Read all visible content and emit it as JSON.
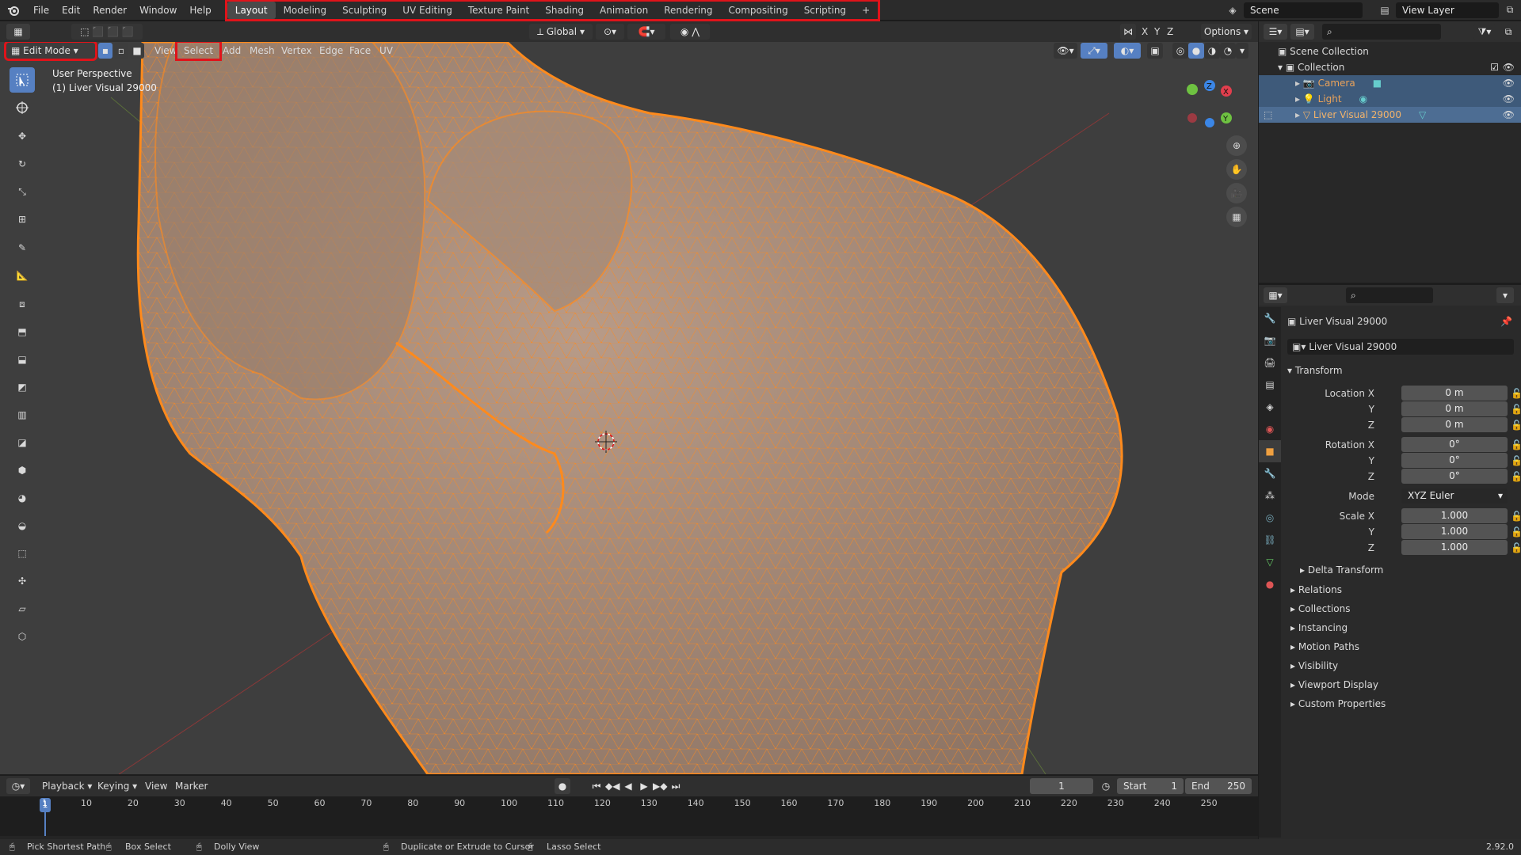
{
  "top_menu": [
    "File",
    "Edit",
    "Render",
    "Window",
    "Help"
  ],
  "workspace_tabs": [
    "Layout",
    "Modeling",
    "Sculpting",
    "UV Editing",
    "Texture Paint",
    "Shading",
    "Animation",
    "Rendering",
    "Compositing",
    "Scripting",
    "+"
  ],
  "scene": "Scene",
  "view_layer": "View Layer",
  "header": {
    "transform_orientation": "Global",
    "axes": [
      "X",
      "Y",
      "Z"
    ],
    "options": "Options"
  },
  "viewport_header": {
    "mode": "Edit Mode",
    "menus": [
      "View",
      "Select",
      "Add",
      "Mesh",
      "Vertex",
      "Edge",
      "Face",
      "UV"
    ]
  },
  "viewport": {
    "perspective_label": "User Perspective",
    "object_label": "(1) Liver Visual 29000",
    "gizmo": {
      "x": "X",
      "y": "Y",
      "z": "Z"
    }
  },
  "outliner": {
    "scene_collection": "Scene Collection",
    "collection": "Collection",
    "items": [
      "Camera",
      "Light",
      "Liver Visual 29000"
    ]
  },
  "properties": {
    "object_name": "Liver Visual 29000",
    "datablock_name": "Liver Visual 29000",
    "transform_title": "Transform",
    "location_label": "Location X",
    "rotation_label": "Rotation X",
    "scale_label": "Scale X",
    "axis_y": "Y",
    "axis_z": "Z",
    "location": [
      "0 m",
      "0 m",
      "0 m"
    ],
    "rotation": [
      "0°",
      "0°",
      "0°"
    ],
    "mode_label": "Mode",
    "mode_value": "XYZ Euler",
    "scale": [
      "1.000",
      "1.000",
      "1.000"
    ],
    "delta_transform": "Delta Transform",
    "panels": [
      "Relations",
      "Collections",
      "Instancing",
      "Motion Paths",
      "Visibility",
      "Viewport Display",
      "Custom Properties"
    ]
  },
  "timeline": {
    "menus": [
      "Playback",
      "Keying",
      "View",
      "Marker"
    ],
    "current_frame": "1",
    "start_label": "Start",
    "start": "1",
    "end_label": "End",
    "end": "250",
    "ticks": [
      "1",
      "10",
      "20",
      "30",
      "40",
      "50",
      "60",
      "70",
      "80",
      "90",
      "100",
      "110",
      "120",
      "130",
      "140",
      "150",
      "160",
      "170",
      "180",
      "190",
      "200",
      "210",
      "220",
      "230",
      "240",
      "250"
    ]
  },
  "statusbar": {
    "hints": [
      "Pick Shortest Path",
      "Box Select",
      "Dolly View",
      "Duplicate or Extrude to Cursor",
      "Lasso Select"
    ],
    "version": "2.92.0"
  },
  "colors": {
    "accent": "#5680c2",
    "highlight": "#e0131a",
    "mesh_wire": "#ff8a1c",
    "mesh_fill": "#a68a78"
  }
}
